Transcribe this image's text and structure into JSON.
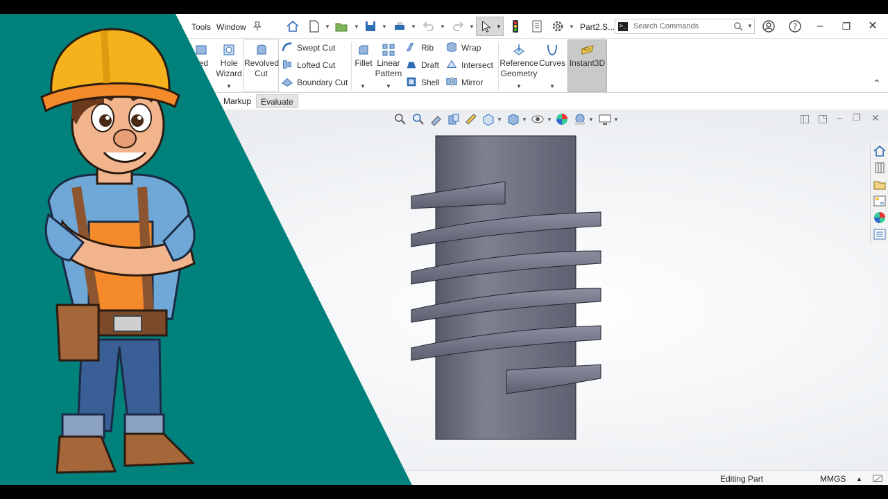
{
  "menu": {
    "tools": "Tools",
    "window": "Window",
    "partial_left": "t"
  },
  "document": {
    "title": "Part2.S..."
  },
  "search": {
    "placeholder": "Search Commands"
  },
  "ribbon": {
    "extruded_partial": "ded",
    "hole_wizard": [
      "Hole",
      "Wizard"
    ],
    "revolved_cut": [
      "Revolved",
      "Cut"
    ],
    "swept_cut": "Swept Cut",
    "lofted_cut": "Lofted Cut",
    "boundary_cut": "Boundary Cut",
    "fillet": "Fillet",
    "linear_pattern": [
      "Linear",
      "Pattern"
    ],
    "rib": "Rib",
    "draft": "Draft",
    "shell": "Shell",
    "wrap": "Wrap",
    "intersect": "Intersect",
    "mirror": "Mirror",
    "reference_geometry": [
      "Reference",
      "Geometry"
    ],
    "curves": "Curves",
    "instant3d": "Instant3D"
  },
  "tabs": [
    {
      "label": "Markup"
    },
    {
      "label": "Evaluate"
    }
  ],
  "status": {
    "mode": "Editing Part",
    "units": "MMGS"
  },
  "colors": {
    "overlay_teal": "#00817B",
    "ribbon_icon_blue": "#2F6DB5",
    "part_gray": "#6E7280"
  }
}
